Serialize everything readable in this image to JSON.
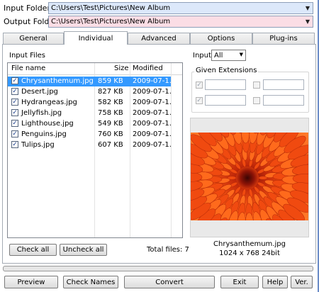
{
  "folders": {
    "input_label": "Input Folder",
    "input_value": "C:\\Users\\Test\\Pictures\\New Album",
    "input_color": "#dce8fa",
    "output_label": "Output Folder",
    "output_value": "C:\\Users\\Test\\Pictures\\New Album",
    "output_color": "#fbdde5"
  },
  "tabs": [
    "General",
    "Individual",
    "Advanced",
    "Options",
    "Plug-ins"
  ],
  "active_tab": "Individual",
  "input_files": {
    "title": "Input Files",
    "columns": [
      "File name",
      "Size",
      "Modified"
    ],
    "rows": [
      {
        "name": "Chrysanthemum.jpg",
        "size": "859 KB",
        "modified": "2009-07-1...",
        "checked": true,
        "selected": true
      },
      {
        "name": "Desert.jpg",
        "size": "827 KB",
        "modified": "2009-07-1...",
        "checked": true,
        "selected": false
      },
      {
        "name": "Hydrangeas.jpg",
        "size": "582 KB",
        "modified": "2009-07-1...",
        "checked": true,
        "selected": false
      },
      {
        "name": "Jellyfish.jpg",
        "size": "758 KB",
        "modified": "2009-07-1...",
        "checked": true,
        "selected": false
      },
      {
        "name": "Lighthouse.jpg",
        "size": "549 KB",
        "modified": "2009-07-1...",
        "checked": true,
        "selected": false
      },
      {
        "name": "Penguins.jpg",
        "size": "760 KB",
        "modified": "2009-07-1...",
        "checked": true,
        "selected": false
      },
      {
        "name": "Tulips.jpg",
        "size": "607 KB",
        "modified": "2009-07-1...",
        "checked": true,
        "selected": false
      }
    ],
    "check_all": "Check all",
    "uncheck_all": "Uncheck all",
    "total_files": "Total files: 7"
  },
  "input_filter": {
    "label": "Input",
    "value": "All"
  },
  "given_extensions": {
    "title": "Given Extensions",
    "checkmark": "✓"
  },
  "preview": {
    "filename": "Chrysanthemum.jpg",
    "info": "1024 x 768  24bit"
  },
  "footer": {
    "preview": "Preview",
    "check_names": "Check Names",
    "convert": "Convert",
    "exit": "Exit",
    "help": "Help",
    "ver": "Ver."
  },
  "selection_color": "#3399ff"
}
